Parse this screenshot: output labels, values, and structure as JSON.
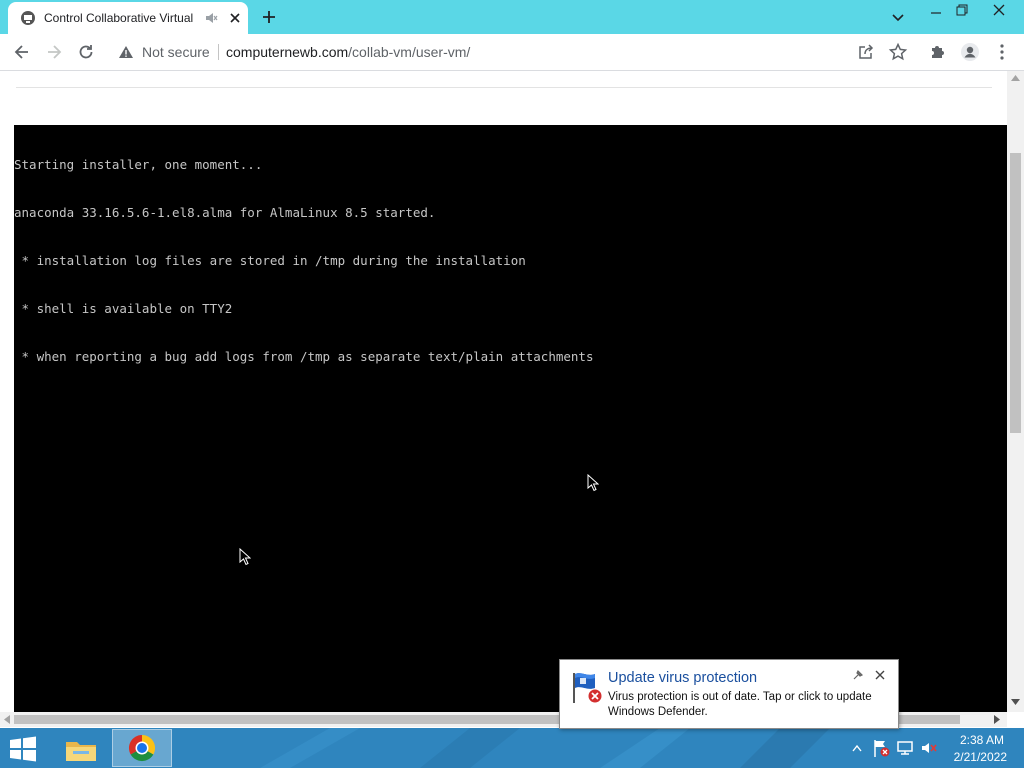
{
  "browser": {
    "tab": {
      "title": "Control Collaborative Virtual"
    },
    "toolbar": {
      "security_label": "Not secure",
      "url_host": "computernewb.com",
      "url_path": "/collab-vm/user-vm/"
    }
  },
  "vm": {
    "console_lines": [
      "Starting installer, one moment...",
      "anaconda 33.16.5.6-1.el8.alma for AlmaLinux 8.5 started.",
      " * installation log files are stored in /tmp during the installation",
      " * shell is available on TTY2",
      " * when reporting a bug add logs from /tmp as separate text/plain attachments"
    ]
  },
  "notification": {
    "title": "Update virus protection",
    "body": "Virus protection is out of date. Tap or click to update Windows Defender."
  },
  "taskbar": {
    "time": "2:38 AM",
    "date": "2/21/2022",
    "pinned": [
      "file-explorer-icon",
      "chrome-icon"
    ]
  },
  "colors": {
    "titlebar": "#5ad7e6",
    "taskbar": "#2f85be",
    "console_bg": "#000000",
    "console_text": "#c6c6c6",
    "toast_title": "#1a4f9e"
  }
}
